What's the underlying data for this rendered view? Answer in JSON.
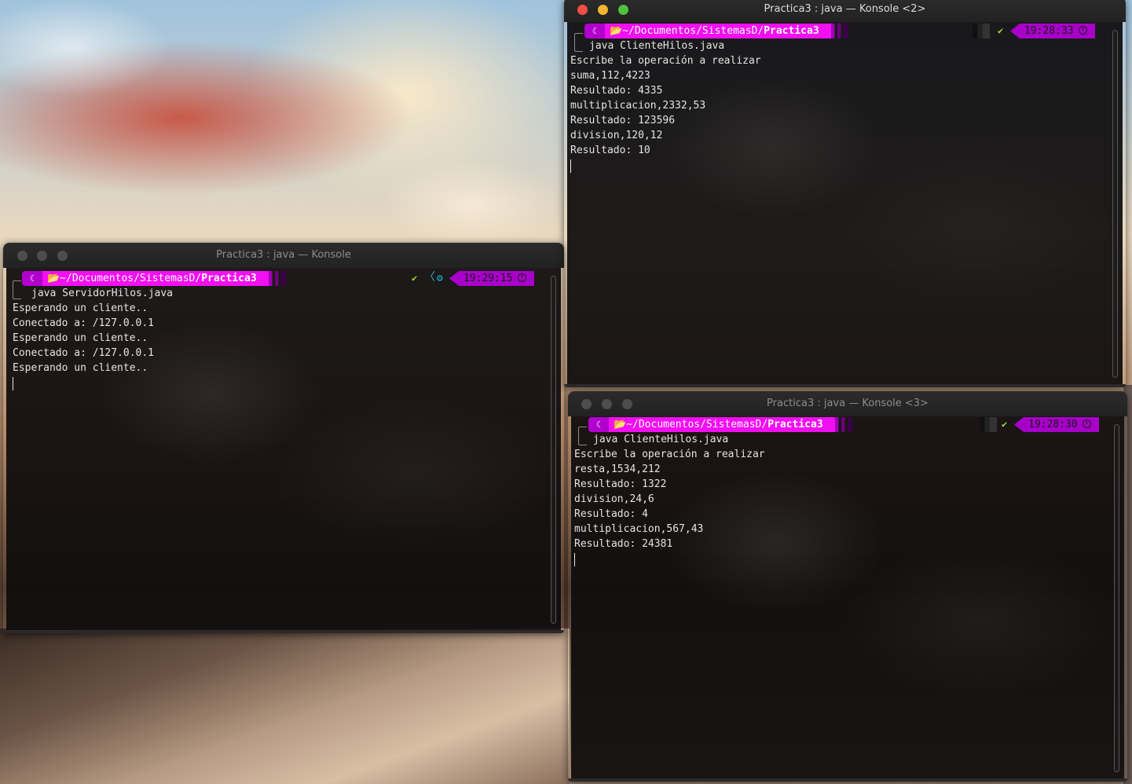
{
  "windows": {
    "server": {
      "title": "Practica3 : java — Konsole",
      "prompt": {
        "os_icon": "☾",
        "folder_icon": "folder-open-icon",
        "path_prefix": "📂~/Documentos/SistemasD/",
        "path_dir": "Practica3",
        "status_check": "✔",
        "chevron": "〈",
        "gear": "⚙",
        "time": "19:29:15"
      },
      "command": "java ServidorHilos.java",
      "output": [
        "Esperando un cliente..",
        "Conectado a: /127.0.0.1",
        "Esperando un cliente..",
        "Conectado a: /127.0.0.1",
        "Esperando un cliente.."
      ]
    },
    "client2": {
      "title": "Practica3 : java — Konsole <2>",
      "prompt": {
        "os_icon": "☾",
        "path_prefix": "📂~/Documentos/SistemasD/",
        "path_dir": "Practica3",
        "status_check": "✔",
        "time": "19:28:33"
      },
      "command": "java ClienteHilos.java",
      "output": [
        "Escribe la operación a realizar",
        "suma,112,4223",
        "Resultado: 4335",
        "multiplicacion,2332,53",
        "Resultado: 123596",
        "division,120,12",
        "Resultado: 10"
      ]
    },
    "client3": {
      "title": "Practica3 : java — Konsole <3>",
      "prompt": {
        "os_icon": "☾",
        "path_prefix": "📂~/Documentos/SistemasD/",
        "path_dir": "Practica3",
        "status_check": "✔",
        "time": "19:28:30"
      },
      "command": "java ClienteHilos.java",
      "output": [
        "Escribe la operación a realizar",
        "resta,1534,212",
        "Resultado: 1322",
        "division,24,6",
        "Resultado: 4",
        "multiplicacion,567,43",
        "Resultado: 24381"
      ]
    }
  },
  "colors": {
    "prompt_path_bg": "#f20ff2",
    "prompt_time_bg": "#a700c8",
    "close_button": "#ee4f45",
    "minimize_button": "#f3b52f",
    "maximize_button": "#4ec13e"
  }
}
